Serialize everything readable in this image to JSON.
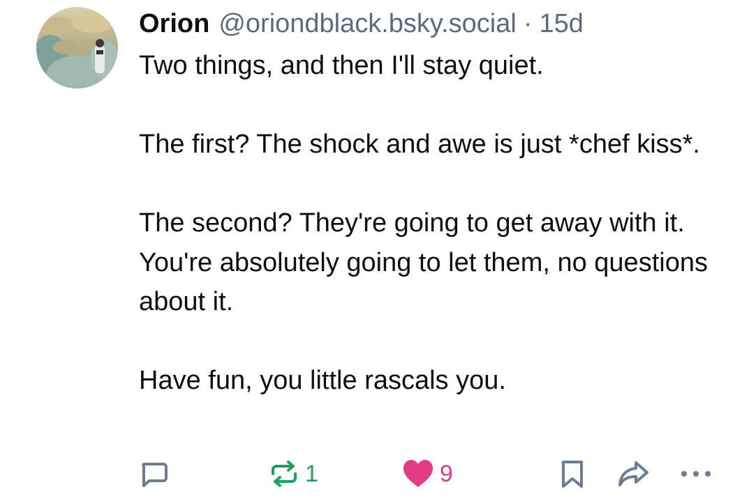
{
  "post": {
    "author": {
      "name": "Orion",
      "handle": "@oriondblack.bsky.social",
      "avatar": "avatar-photo"
    },
    "separator": "·",
    "time_ago": "15d",
    "paragraphs": [
      "Two things, and then I'll stay quiet.",
      "The first? The shock and awe is just *chef kiss*.",
      "The second? They're going to get away with it. You're absolutely going to let them, no questions about it.",
      "Have fun, you little rascals you."
    ]
  },
  "actions": {
    "reply": {
      "icon": "reply-icon"
    },
    "repost": {
      "icon": "repost-icon",
      "count": "1",
      "color": "#1fa05a"
    },
    "like": {
      "icon": "heart-icon",
      "count": "9",
      "color": "#e13d86"
    },
    "bookmark": {
      "icon": "bookmark-icon"
    },
    "share": {
      "icon": "share-icon"
    },
    "more": {
      "icon": "more-icon"
    }
  },
  "colors": {
    "text": "#0b0f14",
    "muted": "#5b6b7d",
    "icon": "#6b7d92"
  }
}
